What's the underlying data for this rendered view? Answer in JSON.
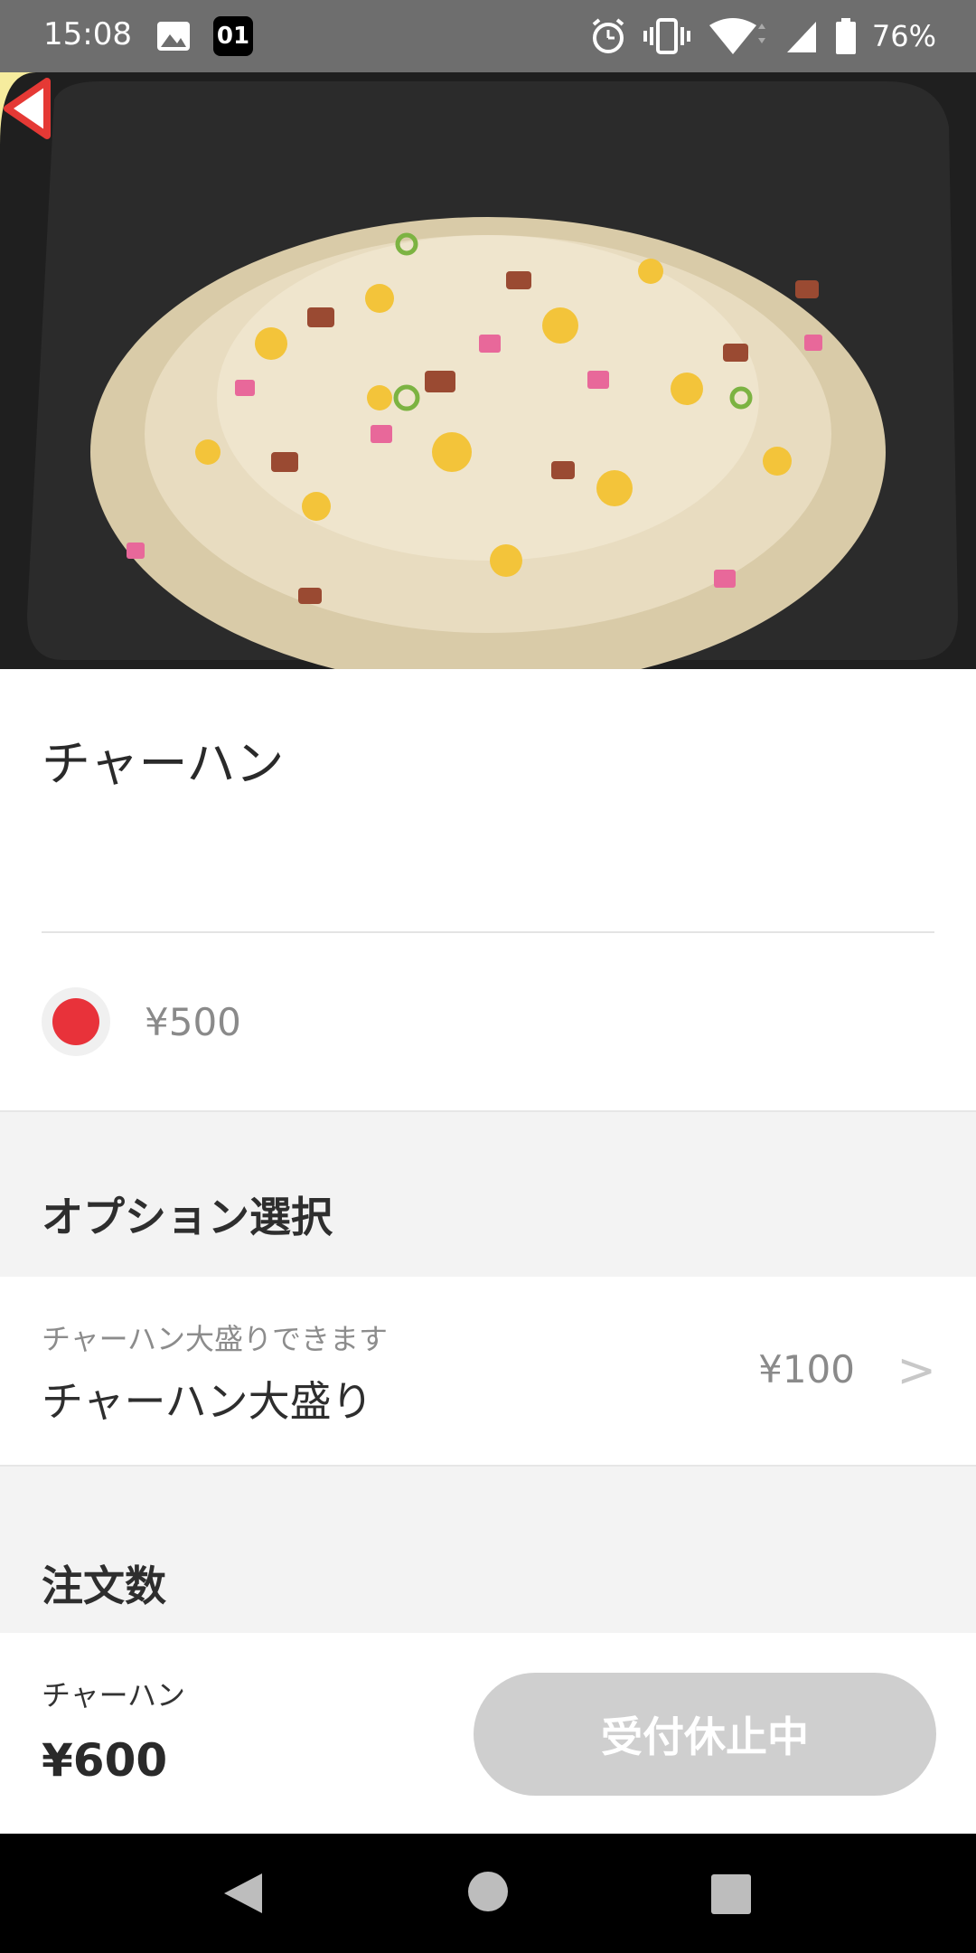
{
  "status_bar": {
    "time": "15:08",
    "notification_badge": "01",
    "battery": "76%"
  },
  "hero": {
    "image": "fried-rice-photo"
  },
  "product": {
    "title": "チャーハン",
    "base_price": "¥500"
  },
  "options": {
    "section_title": "オプション選択",
    "items": [
      {
        "description": "チャーハン大盛りできます",
        "name": "チャーハン大盛り",
        "price": "¥100"
      }
    ]
  },
  "quantity": {
    "section_title": "注文数"
  },
  "footer": {
    "item_name": "チャーハン",
    "total": "¥600",
    "order_button_label": "受付休止中"
  },
  "colors": {
    "accent_red": "#e8323a",
    "button_disabled": "#cfcfcf"
  }
}
